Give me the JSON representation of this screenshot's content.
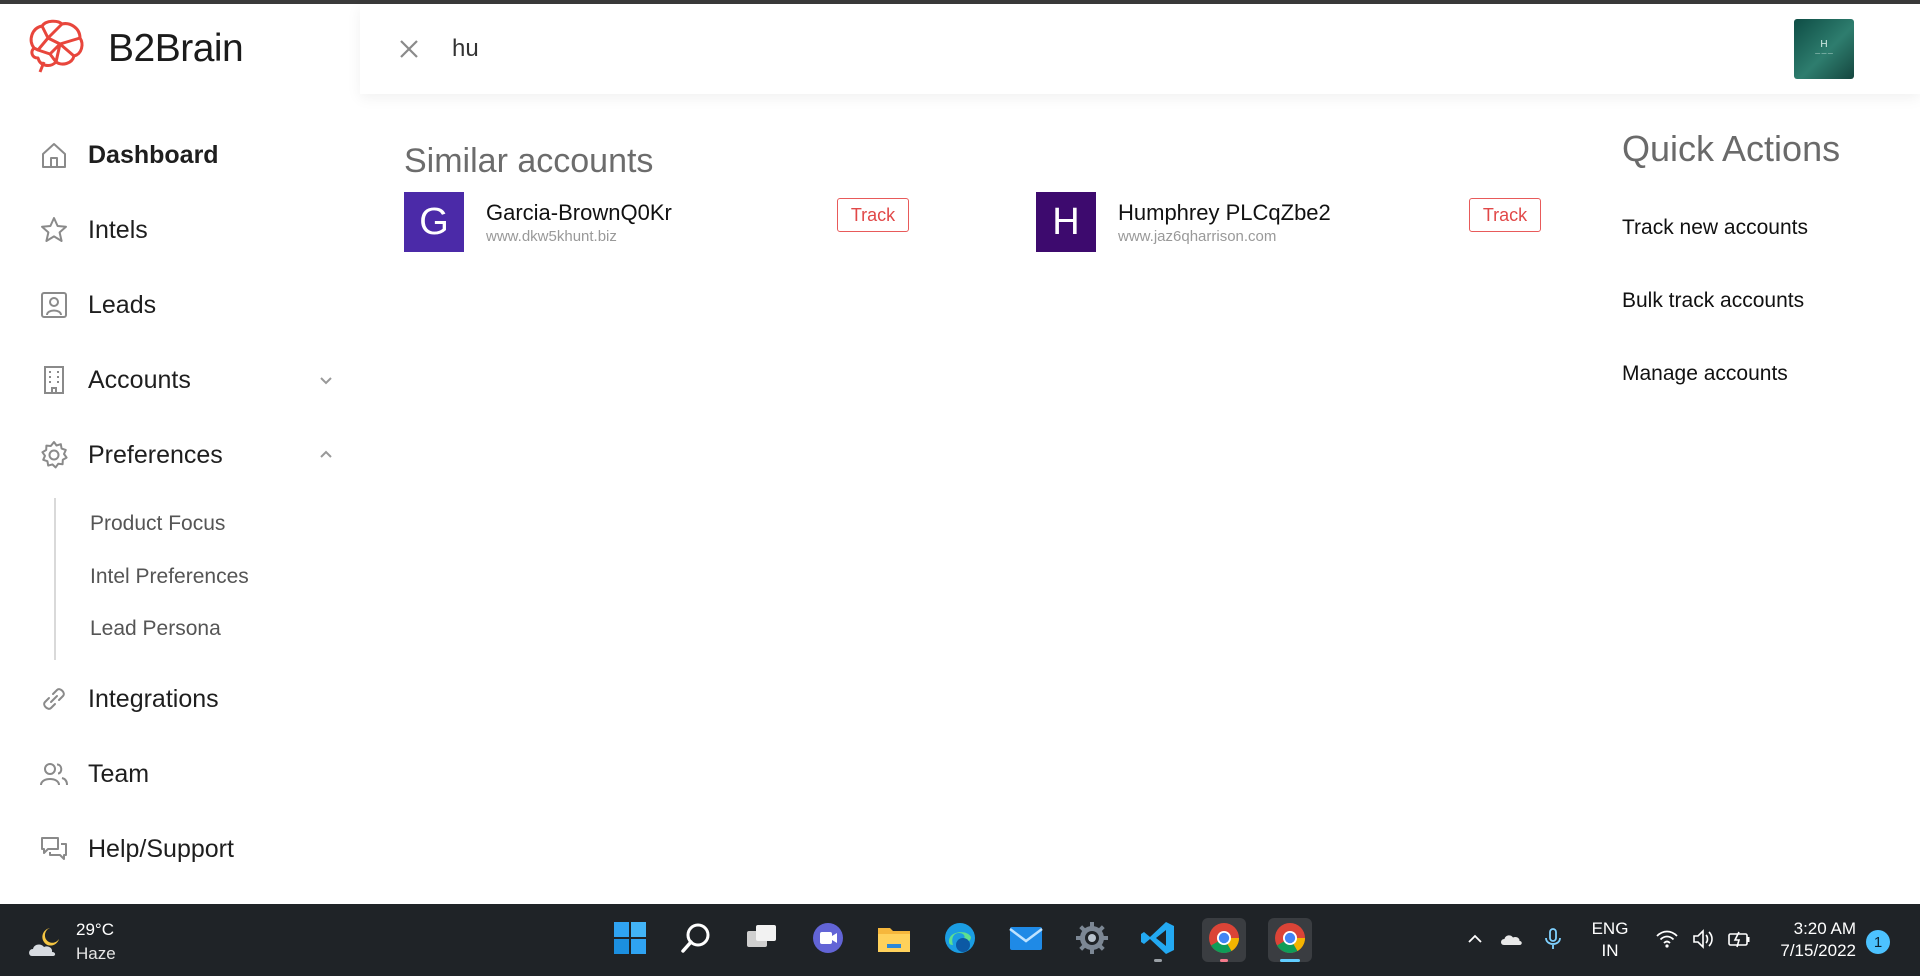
{
  "app": {
    "name": "B2Brain",
    "brand_color": "#e8463c"
  },
  "sidebar": {
    "items": [
      {
        "label": "Dashboard",
        "icon": "home-icon"
      },
      {
        "label": "Intels",
        "icon": "star-icon"
      },
      {
        "label": "Leads",
        "icon": "person-badge-icon"
      },
      {
        "label": "Accounts",
        "icon": "building-icon"
      },
      {
        "label": "Preferences",
        "icon": "gear-icon"
      },
      {
        "label": "Integrations",
        "icon": "link-icon"
      },
      {
        "label": "Team",
        "icon": "team-icon"
      },
      {
        "label": "Help/Support",
        "icon": "chat-icon"
      }
    ],
    "preferences_sub": [
      "Product Focus",
      "Intel Preferences",
      "Lead Persona"
    ]
  },
  "search": {
    "value": "hu"
  },
  "similar_accounts": {
    "title": "Similar accounts",
    "items": [
      {
        "initial": "G",
        "name": "Garcia-BrownQ0Kr",
        "url": "www.dkw5khunt.biz",
        "button": "Track",
        "color": "#4b2aa8"
      },
      {
        "initial": "H",
        "name": "Humphrey PLCqZbe2",
        "url": "www.jaz6qharrison.com",
        "button": "Track",
        "color": "#3d0a6e"
      }
    ]
  },
  "quick_actions": {
    "title": "Quick Actions",
    "items": [
      "Track new accounts",
      "Bulk track accounts",
      "Manage accounts"
    ]
  },
  "taskbar": {
    "weather": {
      "temp": "29°C",
      "condition": "Haze"
    },
    "language": {
      "line1": "ENG",
      "line2": "IN"
    },
    "clock": {
      "time": "3:20 AM",
      "date": "7/15/2022"
    },
    "notifications": "1"
  }
}
